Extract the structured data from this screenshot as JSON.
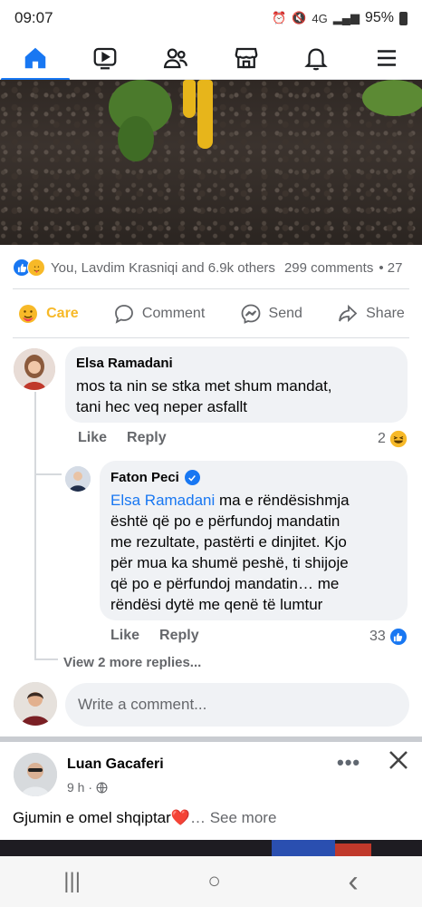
{
  "status_bar": {
    "time": "09:07",
    "network": "4G",
    "battery": "95%",
    "icons": [
      "alarm-icon",
      "mute-icon",
      "signal-icon",
      "battery-icon"
    ]
  },
  "top_nav": {
    "tabs": [
      "home-icon",
      "video-icon",
      "friends-icon",
      "marketplace-icon",
      "notifications-icon",
      "menu-icon"
    ],
    "accent": "#1877f2"
  },
  "post": {
    "reactions_summary": "You, Lavdim Krasniqi and 6.9k others",
    "comments_count": "299 comments",
    "shares_partial": "• 27",
    "actions": {
      "care": "Care",
      "comment": "Comment",
      "send": "Send",
      "share": "Share"
    }
  },
  "comments": [
    {
      "author": "Elsa Ramadani",
      "text_line1": "mos ta nin se stka met shum mandat,",
      "text_line2": "tani hec veq neper asfallt",
      "like": "Like",
      "reply": "Reply",
      "reaction_count": "2"
    }
  ],
  "reply": {
    "author": "Faton Peci",
    "mention": "Elsa Ramadani",
    "line1": " ma e rëndësishmja",
    "line2": "është që po e përfundoj mandatin",
    "line3": "me rezultate, pastërti e dinjitet. Kjo",
    "line4": "për mua ka shumë peshë, ti shijoje",
    "line5": "që po e përfundoj mandatin… me",
    "line6": "rëndësi dytë me qenë të lumtur",
    "like": "Like",
    "reply": "Reply",
    "reaction_count": "33"
  },
  "view_more_replies": "View 2 more replies...",
  "write_comment_placeholder": "Write a comment...",
  "next_post": {
    "author": "Luan Gacaferi",
    "time": "9 h ·",
    "text": "Gjumin e omel shqiptar",
    "heart": "❤️",
    "see_more": "… See more"
  },
  "android_nav": {
    "recents": "|||",
    "home": "○",
    "back": "‹"
  },
  "colors": {
    "accent": "#1877f2",
    "care": "#f7b928",
    "muted_text": "#65676b",
    "bubble_bg": "#f0f2f5"
  }
}
